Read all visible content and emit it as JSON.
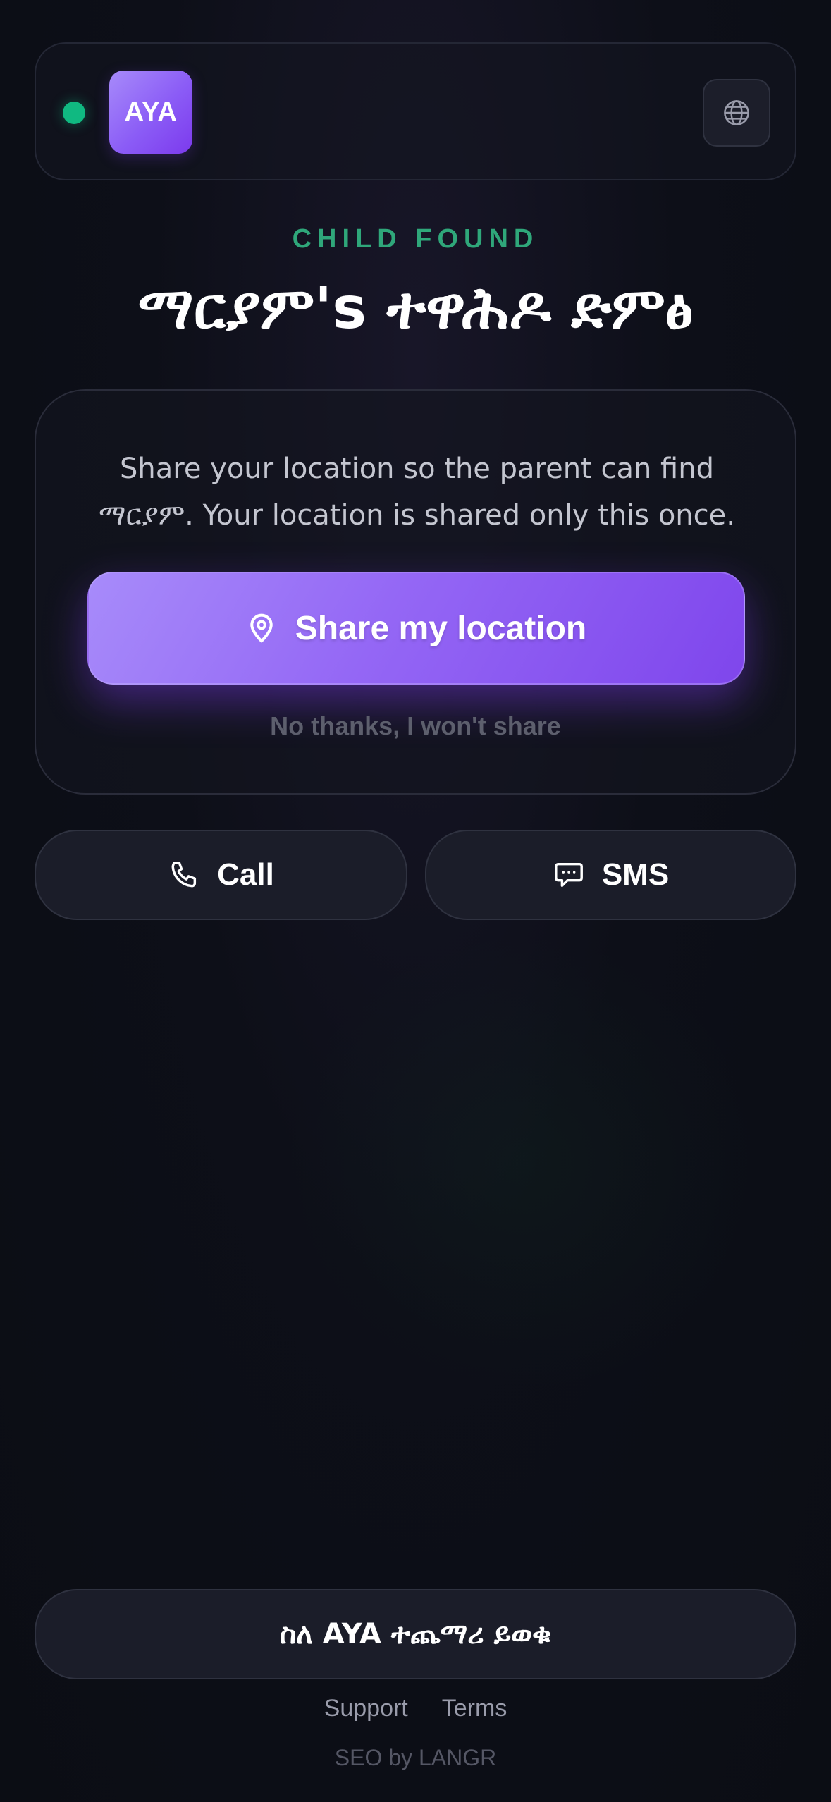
{
  "header": {
    "status": "online",
    "logo_text": "AYA",
    "language_icon": "globe-icon"
  },
  "hero": {
    "eyebrow": "CHILD FOUND",
    "title": "ማርያም's ተዋሕዶ ድምፅ"
  },
  "share_card": {
    "message": "Share your location so the parent can find ማርያም. Your location is shared only this once.",
    "share_button_label": "Share my location",
    "share_button_icon": "map-pin-icon",
    "decline_label": "No thanks, I won't share"
  },
  "contact": {
    "call_label": "Call",
    "call_icon": "phone-icon",
    "sms_label": "SMS",
    "sms_icon": "chat-bubble-icon"
  },
  "footer": {
    "about_label": "ስለ AYA ተጨማሪ ይወቁ",
    "support_label": "Support",
    "terms_label": "Terms",
    "credit": "SEO by LANGR"
  },
  "colors": {
    "accent_purple": "#8b5cf6",
    "status_green": "#10b981",
    "eyebrow_green": "#2fa77a",
    "background": "#0d0f18"
  }
}
